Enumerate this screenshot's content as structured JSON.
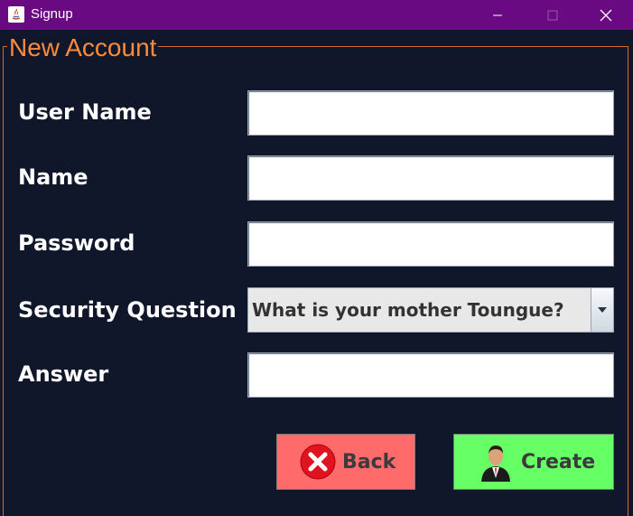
{
  "window": {
    "title": "Signup"
  },
  "form": {
    "group_title": "New Account",
    "fields": [
      {
        "label": "User Name",
        "value": ""
      },
      {
        "label": "Name",
        "value": ""
      },
      {
        "label": "Password",
        "value": ""
      },
      {
        "label": "Security Question",
        "selected": "What is your mother Toungue?"
      },
      {
        "label": "Answer",
        "value": ""
      }
    ]
  },
  "buttons": {
    "back_label": "Back",
    "create_label": "Create"
  },
  "colors": {
    "titlebar": "#6a0a83",
    "background": "#10172a",
    "group_title": "#ff8a3a",
    "back_button": "#ff6b6b",
    "create_button": "#66ff66"
  },
  "icons": [
    "java-icon",
    "minimize-icon",
    "maximize-icon",
    "close-icon",
    "chevron-down-icon",
    "cancel-icon",
    "user-avatar-icon"
  ]
}
